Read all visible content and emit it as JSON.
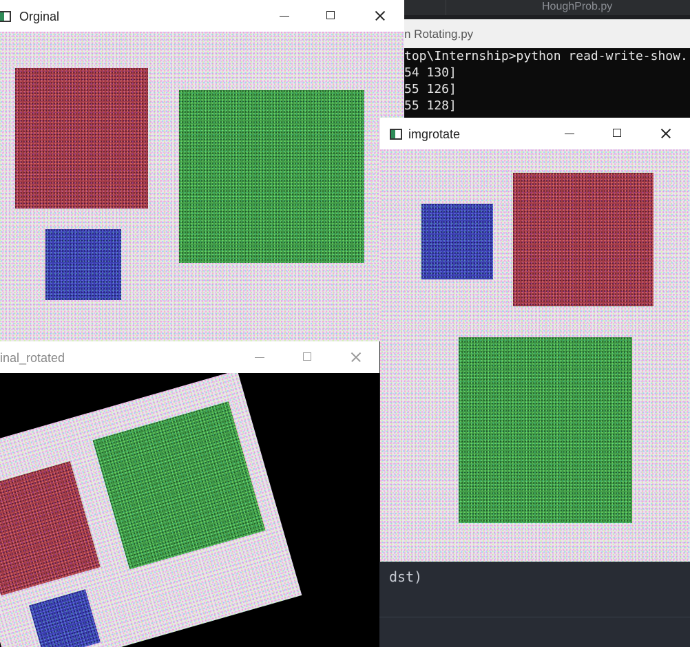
{
  "background": {
    "editor_tab": "HoughProb.py",
    "editor_title": "n  Rotating.py",
    "console_lines": [
      "top\\Internship>python read-write-show.",
      "54 130]",
      "55 126]",
      "55 128]"
    ],
    "code_line": "dst)"
  },
  "windows": {
    "original": {
      "title": "Orginal"
    },
    "rotated": {
      "title": "inal_rotated"
    },
    "imgrotate": {
      "title": "imgrotate"
    }
  },
  "colors": {
    "red_square": "#a43a48",
    "green_square": "#3f9a47",
    "blue_square": "#3c3fb4",
    "noise_background": "#e9e6ea",
    "console_bg": "#0c0c0c"
  }
}
